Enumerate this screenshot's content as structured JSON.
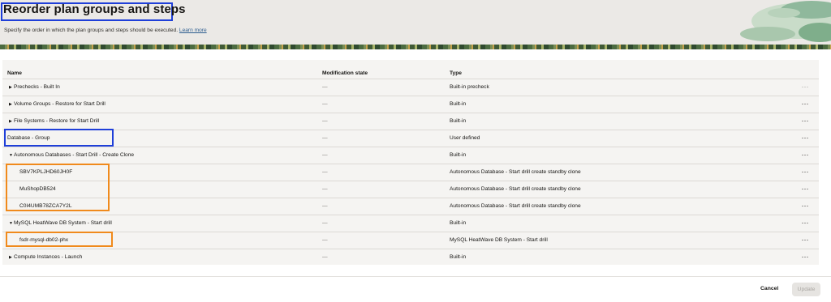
{
  "header": {
    "title": "Reorder plan groups and steps",
    "subtitle": "Specify the order in which the plan groups and steps should be executed.",
    "learn_more": "Learn more"
  },
  "table": {
    "columns": {
      "name": "Name",
      "modification": "Modification state",
      "type": "Type"
    },
    "rows": [
      {
        "name": "Prechecks - Built In",
        "modification": "—",
        "type": "Built-in precheck",
        "expander": "collapsed"
      },
      {
        "name": "Volume Groups - Restore for Start Drill",
        "modification": "—",
        "type": "Built-in",
        "expander": "collapsed"
      },
      {
        "name": "File Systems - Restore for Start Drill",
        "modification": "—",
        "type": "Built-in",
        "expander": "collapsed"
      },
      {
        "name": "Database - Group",
        "modification": "—",
        "type": "User defined",
        "expander": "none"
      },
      {
        "name": "Autonomous Databases - Start Drill - Create Clone",
        "modification": "—",
        "type": "Built-in",
        "expander": "expanded"
      },
      {
        "name": "SBV7KPLJHD60JH0F",
        "modification": "—",
        "type": "Autonomous Database - Start drill create standby clone",
        "expander": "child"
      },
      {
        "name": "MuShopDB524",
        "modification": "—",
        "type": "Autonomous Database - Start drill create standby clone",
        "expander": "child"
      },
      {
        "name": "C0I4UMB78ZCA7Y2L",
        "modification": "—",
        "type": "Autonomous Database - Start drill create standby clone",
        "expander": "child"
      },
      {
        "name": "MySQL HeatWave DB System - Start drill",
        "modification": "—",
        "type": "Built-in",
        "expander": "expanded"
      },
      {
        "name": "fsdr-mysql-db02-phx",
        "modification": "—",
        "type": "MySQL HeatWave DB System - Start drill",
        "expander": "child"
      },
      {
        "name": "Compute Instances - Launch",
        "modification": "—",
        "type": "Built-in",
        "expander": "collapsed"
      }
    ],
    "actions_glyph": "···",
    "caret_collapsed": "▶",
    "caret_expanded": "▼"
  },
  "footer": {
    "cancel": "Cancel",
    "update": "Update"
  },
  "colors": {
    "highlight_blue": "#1f3fd9",
    "highlight_orange": "#f08a1c",
    "link": "#2c5d8f",
    "disabled_button": "#e6e4e1"
  },
  "icons": {
    "row_actions": "ellipsis-icon",
    "collapsed": "caret-right-icon",
    "expanded": "caret-down-icon"
  }
}
